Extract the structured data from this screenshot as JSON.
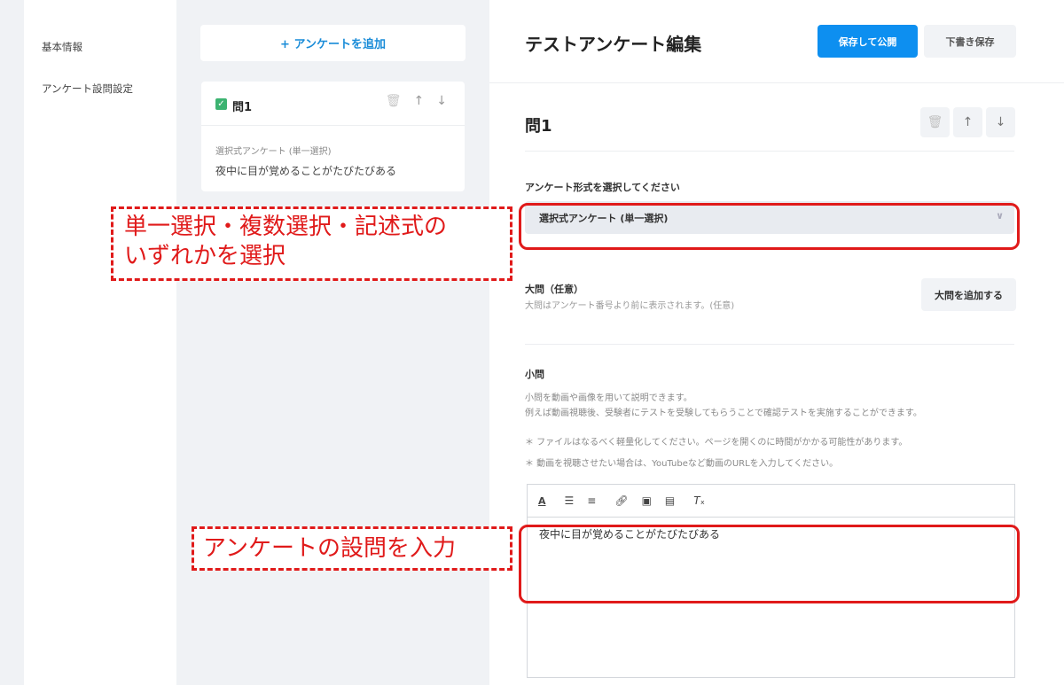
{
  "nav": {
    "items": [
      {
        "label": "基本情報"
      },
      {
        "label": "アンケート設問設定"
      }
    ]
  },
  "middle": {
    "add_button": "+ アンケートを追加",
    "card": {
      "title": "問1",
      "type": "選択式アンケート (単一選択)",
      "text": "夜中に目が覚めることがたびたびある"
    }
  },
  "header": {
    "title": "テストアンケート編集",
    "publish_button": "保存して公開",
    "draft_button": "下書き保存"
  },
  "question": {
    "title": "問1",
    "format_label": "アンケート形式を選択してください",
    "format_value": "選択式アンケート (単一選択)",
    "section": {
      "title": "大問（任意）",
      "desc": "大問はアンケート番号より前に表示されます。(任意)",
      "add_button": "大問を追加する"
    },
    "sub": {
      "title": "小問",
      "desc1": "小問を動画や画像を用いて説明できます。",
      "desc2": "例えば動画視聴後、受験者にテストを受験してもらうことで確認テストを実施することができます。",
      "note1": "＊ ファイルはなるべく軽量化してください。ページを開くのに時間がかかる可能性があります。",
      "note2": "＊ 動画を視聴させたい場合は、YouTubeなど動画のURLを入力してください。"
    },
    "editor_text": "夜中に目が覚めることがたびたびある"
  },
  "annotations": {
    "select_note_line1": "単一選択・複数選択・記述式の",
    "select_note_line2": "いずれかを選択",
    "input_note": "アンケートの設問を入力"
  },
  "colors": {
    "accent": "#0d8ff0",
    "annotation": "#e01a1a",
    "check": "#3cb371"
  }
}
